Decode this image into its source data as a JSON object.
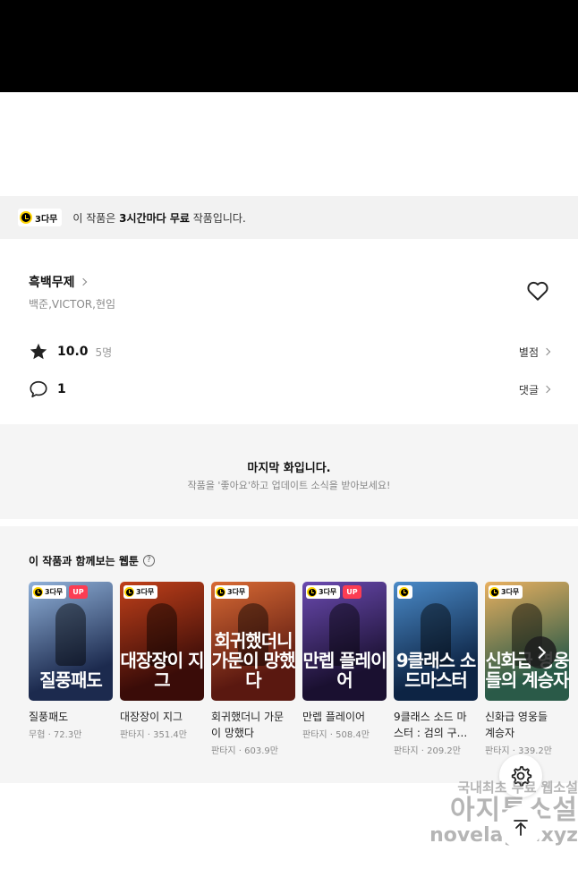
{
  "notice": {
    "badge": "3다무",
    "prefix": "이 작품은 ",
    "bold": "3시간마다 무료",
    "suffix": " 작품입니다."
  },
  "work": {
    "title": "흑백무제",
    "authors": "백준,VICTOR,현임",
    "rating": "10.0",
    "rating_count": "5명",
    "rating_link": "별점",
    "comment_count": "1",
    "comment_link": "댓글"
  },
  "last_episode": {
    "title": "마지막 화입니다.",
    "subtitle": "작품을 '좋아요'하고 업데이트 소식을 받아보세요!"
  },
  "recommendations": {
    "heading": "이 작품과 함께보는 웹툰",
    "help": "?",
    "items": [
      {
        "title": "질풍패도",
        "title2": "",
        "meta": "무협 · 72.3만",
        "badge": "3다무",
        "up": "UP",
        "art": "질풍패도",
        "colors": [
          "#1c2a4e",
          "#8fb0d8"
        ]
      },
      {
        "title": "대장장이 지그",
        "title2": "",
        "meta": "판타지 · 351.4만",
        "badge": "3다무",
        "up": "",
        "art": "대장장이 지그",
        "colors": [
          "#3a0c08",
          "#c0401a"
        ]
      },
      {
        "title": "회귀했더니 가문",
        "title2": "이 망했다",
        "meta": "판타지 · 603.9만",
        "badge": "3다무",
        "up": "",
        "art": "회귀했더니 가문이 망했다",
        "colors": [
          "#5a1810",
          "#d86a34"
        ]
      },
      {
        "title": "만렙 플레이어",
        "title2": "",
        "meta": "판타지 · 508.4만",
        "badge": "3다무",
        "up": "UP",
        "art": "만렙 플레이어",
        "colors": [
          "#1a1030",
          "#6a4ab0"
        ]
      },
      {
        "title": "9클래스 소드 마",
        "title2": "스터 : 검의 구...",
        "meta": "판타지 · 209.2만",
        "badge": "",
        "up": "",
        "art": "9클래스 소드마스터",
        "colors": [
          "#0d2444",
          "#4a8ac8"
        ]
      },
      {
        "title": "신화급 영웅들",
        "title2": "계승자",
        "meta": "판타지 · 339.2만",
        "badge": "3다무",
        "up": "",
        "art": "신화급 영웅들의 계승자",
        "colors": [
          "#2a5a48",
          "#e8b060"
        ]
      }
    ]
  },
  "watermark": {
    "line1": "국내최초 무료 웹소설",
    "line2": "아지툰소설",
    "line3": "novelagit.xyz"
  },
  "icons": {
    "heart": "heart-icon",
    "star": "star-icon",
    "comment": "comment-icon",
    "settings": "gear-icon",
    "top": "arrow-up-icon",
    "next": "chevron-right-icon"
  }
}
